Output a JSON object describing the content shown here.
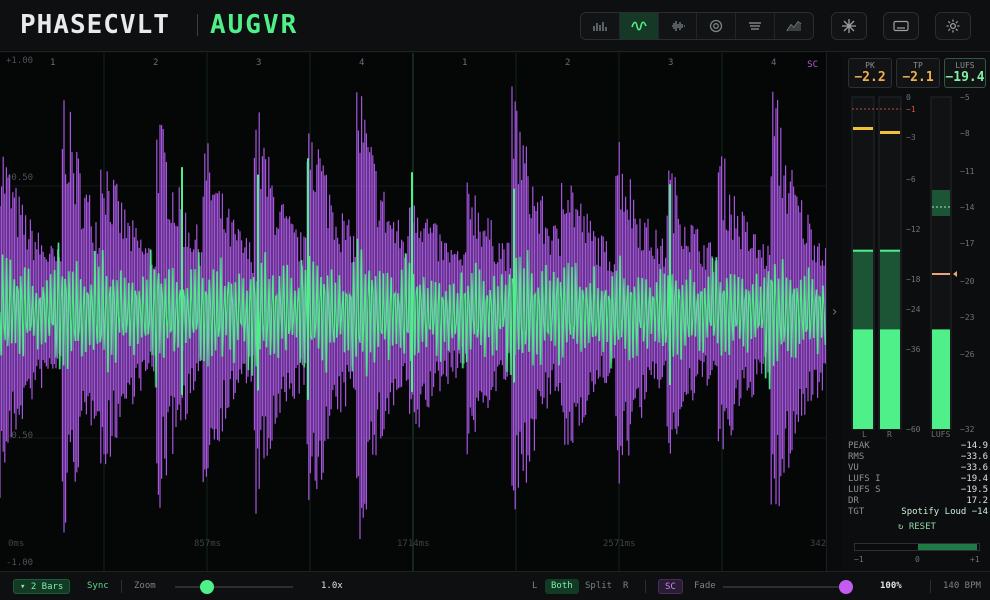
{
  "header": {
    "brand": "PHASECVLT",
    "product": "AUGVR",
    "modes": [
      {
        "icon": "spectrum-bars-icon",
        "active": false
      },
      {
        "icon": "waveform-icon",
        "active": true
      },
      {
        "icon": "oscilloscope-icon",
        "active": false
      },
      {
        "icon": "vectorscope-icon",
        "active": false
      },
      {
        "icon": "loudness-bowl-icon",
        "active": false
      },
      {
        "icon": "graph-icon",
        "active": false
      }
    ],
    "tools": [
      "freeze-icon",
      "keyboard-icon",
      "gear-icon"
    ]
  },
  "waveform": {
    "y_labels": [
      "+1.00",
      "+0.50",
      "-0.50",
      "-1.00"
    ],
    "bar_numbers": [
      "1",
      "2",
      "3",
      "4",
      "1",
      "2",
      "3",
      "4"
    ],
    "sidechain_flag": "SC",
    "time_labels": [
      "0ms",
      "857ms",
      "1714ms",
      "2571ms",
      "342"
    ],
    "colors": {
      "main": "#4ff08a",
      "sidechain": "#b35cf0"
    }
  },
  "meters": {
    "badges": [
      {
        "title": "PK",
        "value": "−2.2",
        "color": "#f0b04f"
      },
      {
        "title": "TP",
        "value": "−2.1",
        "color": "#f0b04f"
      },
      {
        "title": "LUFS",
        "value": "−19.4",
        "color": "#7ff0a8"
      }
    ],
    "peak_scale": [
      "0",
      "−1",
      "−3",
      "−6",
      "−12",
      "−18",
      "−24",
      "−36",
      "−60"
    ],
    "lufs_scale": [
      "−5",
      "−8",
      "−11",
      "−14",
      "−17",
      "−20",
      "−23",
      "−26",
      "−32"
    ],
    "channel_labels": [
      "L",
      "R",
      "LUFS"
    ],
    "levels": {
      "L": 0.3,
      "R": 0.3,
      "L_rms": 0.54,
      "R_rms": 0.54,
      "lufs": 0.3,
      "lufs_range": 0.72
    },
    "stats": [
      {
        "k": "PEAK",
        "v": "−14.9"
      },
      {
        "k": "RMS",
        "v": "−33.6"
      },
      {
        "k": "VU",
        "v": "−33.6"
      },
      {
        "k": "LUFS I",
        "v": "−19.4"
      },
      {
        "k": "LUFS S",
        "v": "−19.5"
      },
      {
        "k": "DR",
        "v": "17.2"
      },
      {
        "k": "TGT",
        "v": "Spotify Loud −14"
      }
    ],
    "reset": "↻ RESET",
    "balance_labels": [
      "−1",
      "0",
      "+1"
    ],
    "balance_value": 0.95
  },
  "footer": {
    "bars": "▾ 2 Bars",
    "sync": "Sync",
    "zoom_label": "Zoom",
    "zoom_value": "1.0x",
    "channel_l": "L",
    "channel_both": "Both",
    "channel_split": "Split",
    "channel_r": "R",
    "sc": "SC",
    "fade_label": "Fade",
    "fade_value": "100%",
    "bpm": "140 BPM"
  }
}
